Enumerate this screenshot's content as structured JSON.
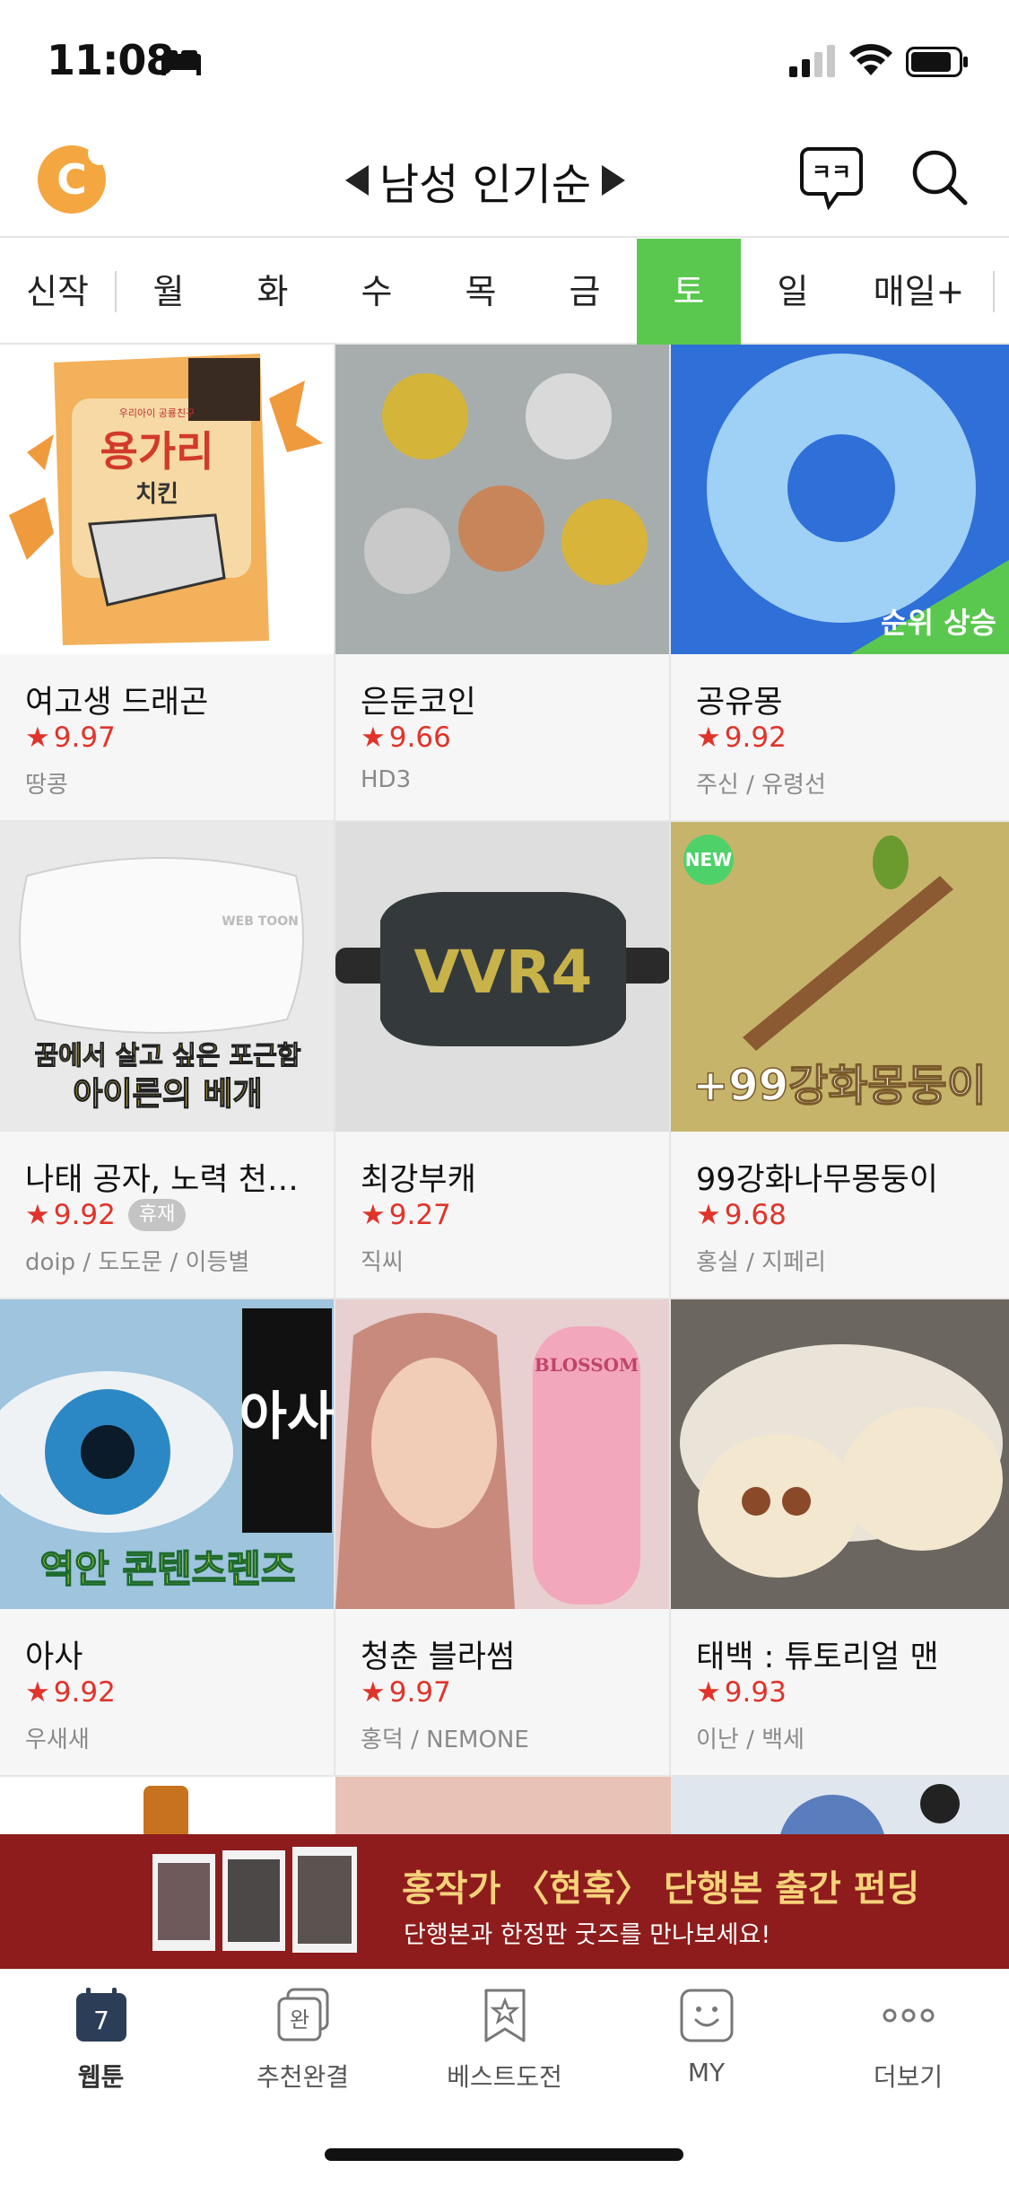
{
  "status": {
    "time": "11:08"
  },
  "header": {
    "logo_letter": "C",
    "sort_label": "남성 인기순",
    "chat_icon_text": "ㅋㅋ"
  },
  "tabs": [
    "신작",
    "월",
    "화",
    "수",
    "목",
    "금",
    "토",
    "일",
    "매일+"
  ],
  "active_tab": "토",
  "cards": [
    {
      "title": "여고생 드래곤",
      "rating": "9.97",
      "author": "땅콩",
      "thumb_caption": ""
    },
    {
      "title": "은둔코인",
      "rating": "9.66",
      "author": "HD3",
      "thumb_caption": ""
    },
    {
      "title": "공유몽",
      "rating": "9.92",
      "author": "주신 / 유령선",
      "badge": "순위 상승"
    },
    {
      "title": "나태 공자, 노력 천…",
      "rating": "9.92",
      "author": "doip / 도도문 / 이등별",
      "status_badge": "휴재",
      "thumb_caption": "꿈에서 살고 싶은 포근함\n아이른의 베개"
    },
    {
      "title": "최강부캐",
      "rating": "9.27",
      "author": "직씨",
      "thumb_caption": "VVR4"
    },
    {
      "title": "99강화나무몽둥이",
      "rating": "9.68",
      "author": "홍실 / 지페리",
      "new_label": "NEW",
      "thumb_caption": "+99강화몽둥이"
    },
    {
      "title": "아사",
      "rating": "9.92",
      "author": "우새새",
      "thumb_caption": "역안 콘텐츠렌즈"
    },
    {
      "title": "청춘 블라썸",
      "rating": "9.97",
      "author": "홍덕 / NEMONE",
      "thumb_caption": "BLOSSOM"
    },
    {
      "title": "태백 : 튜토리얼 맨",
      "rating": "9.93",
      "author": "이난 / 백세",
      "thumb_caption": ""
    }
  ],
  "thumb_texts": {
    "c0_pack_top": "우리아이 공룡친구",
    "c0_pack_main": "용가리",
    "c0_pack_sub": "치킨",
    "c3_line1": "꿈에서 살고 싶은 포근함",
    "c3_line2": "아이른의 베개",
    "c3_pillow_tag": "WEB TOON",
    "c4_vr": "VVR4",
    "c5_text": "+99강화몽둥이",
    "c6_text": "역안 콘텐츠렌즈",
    "c6_side": "아사",
    "c7_bottle": "BLOSSOM"
  },
  "banner": {
    "title": "홍작가 〈현혹〉 단행본 출간 펀딩",
    "subtitle": "단행본과 한정판 굿즈를 만나보세요!"
  },
  "bottom_nav": [
    {
      "label": "웹툰",
      "icon_text": "7"
    },
    {
      "label": "추천완결",
      "icon_text": "완"
    },
    {
      "label": "베스트도전"
    },
    {
      "label": "MY"
    },
    {
      "label": "더보기"
    }
  ],
  "colors": {
    "accent_green": "#5ac84f",
    "rating_red": "#e0342b",
    "banner_bg": "#8e1c1c"
  }
}
